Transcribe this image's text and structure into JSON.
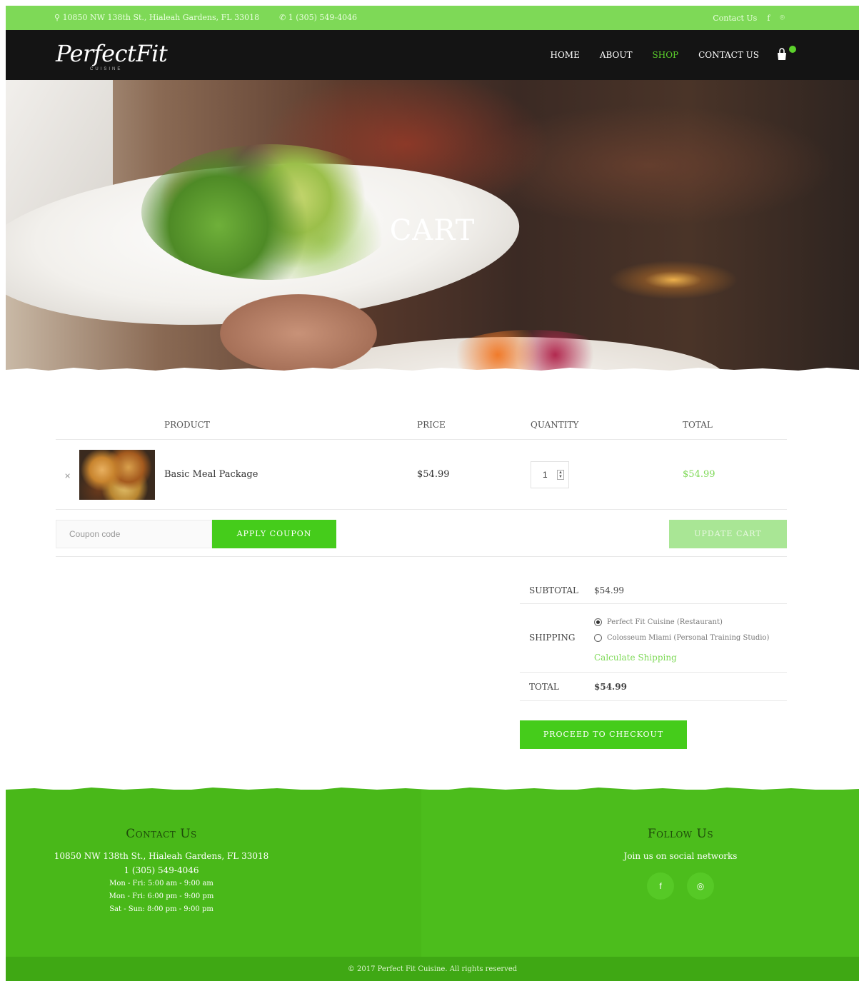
{
  "topbar": {
    "address": "10850 NW 138th St., Hialeah Gardens, FL 33018",
    "phone": "1 (305) 549-4046",
    "contact_link": "Contact Us",
    "facebook_icon": "f",
    "instagram_icon": "⌾"
  },
  "nav": {
    "logo": "PerfectFit",
    "logo_sub": "CUISINE",
    "items": [
      "HOME",
      "ABOUT",
      "SHOP",
      "CONTACT US"
    ],
    "active": "SHOP",
    "accent": "#5cd12c"
  },
  "hero": {
    "title": "CART"
  },
  "cart": {
    "headers": {
      "product": "PRODUCT",
      "price": "PRICE",
      "quantity": "QUANTITY",
      "total": "TOTAL"
    },
    "items": [
      {
        "remove": "×",
        "name": "Basic Meal Package",
        "price": "$54.99",
        "quantity": "1",
        "total": "$54.99"
      }
    ],
    "coupon_placeholder": "Coupon code",
    "apply_label": "APPLY COUPON",
    "update_label": "UPDATE CART"
  },
  "totals": {
    "subtotal_label": "SUBTOTAL",
    "subtotal": "$54.99",
    "shipping_label": "SHIPPING",
    "shipping_options": [
      "Perfect Fit Cuisine (Restaurant)",
      "Colosseum Miami (Personal Training Studio)"
    ],
    "shipping_selected": 0,
    "calc_shipping": "Calculate Shipping",
    "total_label": "TOTAL",
    "total": "$54.99",
    "checkout_label": "PROCEED TO CHECKOUT"
  },
  "footer": {
    "contact_title": "Contact Us",
    "address": "10850 NW 138th St., Hialeah Gardens, FL 33018",
    "phone": "1 (305) 549-4046",
    "hours": [
      "Mon - Fri: 5:00 am - 9:00 am",
      "Mon - Fri: 6:00 pm - 9:00 pm",
      "Sat - Sun: 8:00 pm - 9:00 pm"
    ],
    "follow_title": "Follow Us",
    "follow_text": "Join us on social networks",
    "facebook_icon": "f",
    "instagram_icon": "◎",
    "copyright": "© 2017 Perfect Fit Cuisine. All rights reserved"
  },
  "colors": {
    "green": "#45cc1b",
    "light_green": "#7ed957",
    "dark": "#141414",
    "footer": "#49b819"
  }
}
